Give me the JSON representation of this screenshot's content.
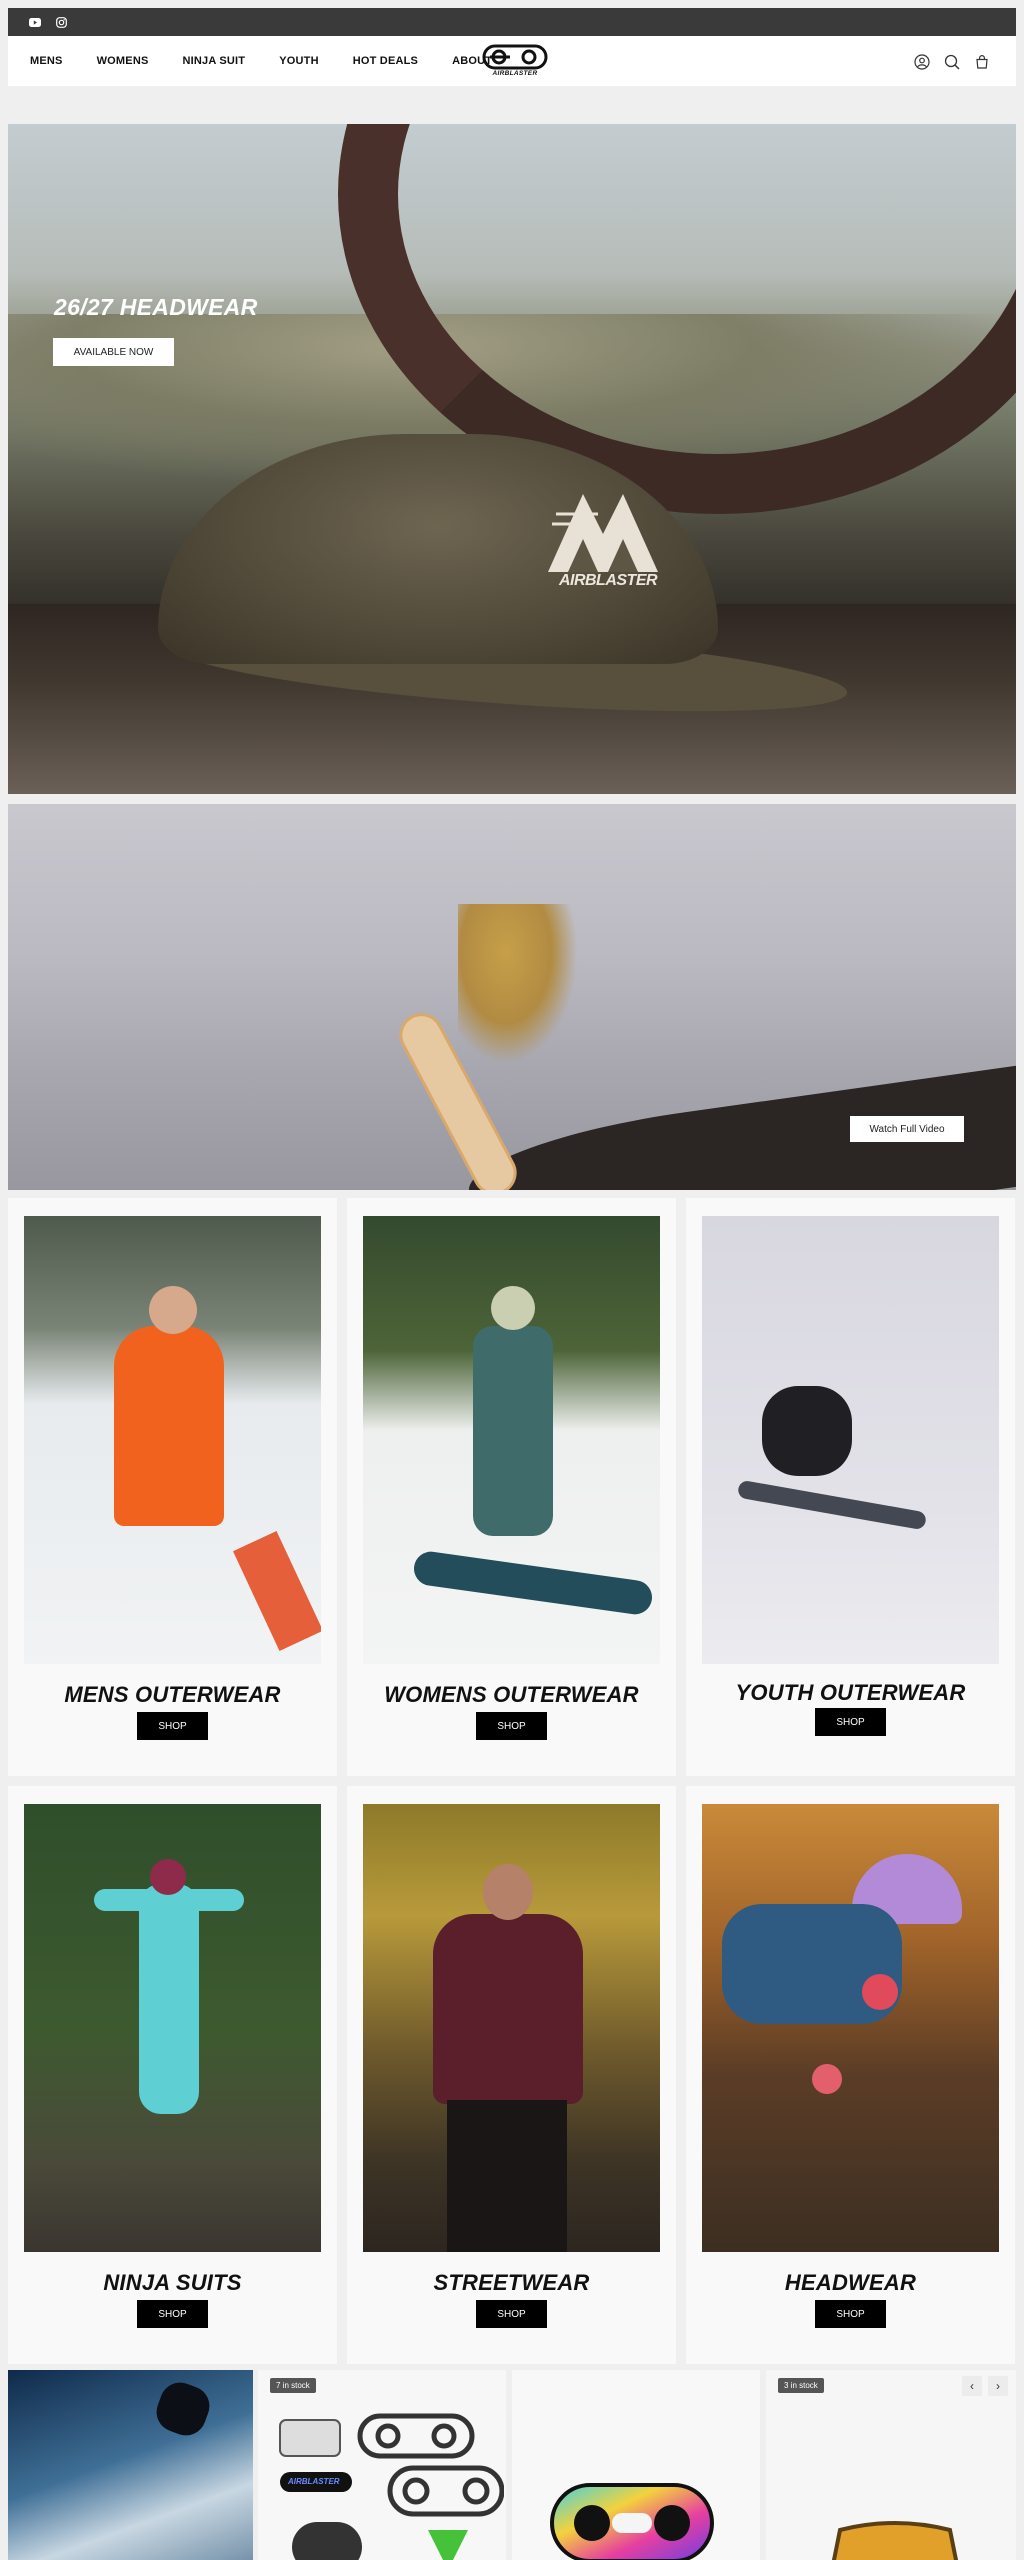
{
  "social": {
    "icons": [
      "youtube-icon",
      "instagram-icon"
    ]
  },
  "nav": {
    "links": [
      "MENS",
      "WOMENS",
      "NINJA SUIT",
      "YOUTH",
      "HOT DEALS",
      "ABOUT"
    ],
    "logo_text": "AIRBLASTER",
    "icons": [
      "account-icon",
      "search-icon",
      "cart-icon"
    ]
  },
  "hero": {
    "title": "26/27 HEADWEAR",
    "button": "AVAILABLE NOW",
    "patch_text": "AIRBLASTER"
  },
  "video": {
    "button": "Watch Full Video"
  },
  "categories": [
    {
      "title": "MENS OUTERWEAR",
      "button": "SHOP"
    },
    {
      "title": "WOMENS OUTERWEAR",
      "button": "SHOP"
    },
    {
      "title": "YOUTH OUTERWEAR",
      "button": "SHOP"
    },
    {
      "title": "NINJA SUITS",
      "button": "SHOP"
    },
    {
      "title": "STREETWEAR",
      "button": "SHOP"
    },
    {
      "title": "HEADWEAR",
      "button": "SHOP"
    }
  ],
  "products": {
    "badges": [
      "7 in stock",
      "3 in stock"
    ],
    "sticker_text": "AIRBLASTER",
    "prev_label": "‹",
    "next_label": "›"
  }
}
